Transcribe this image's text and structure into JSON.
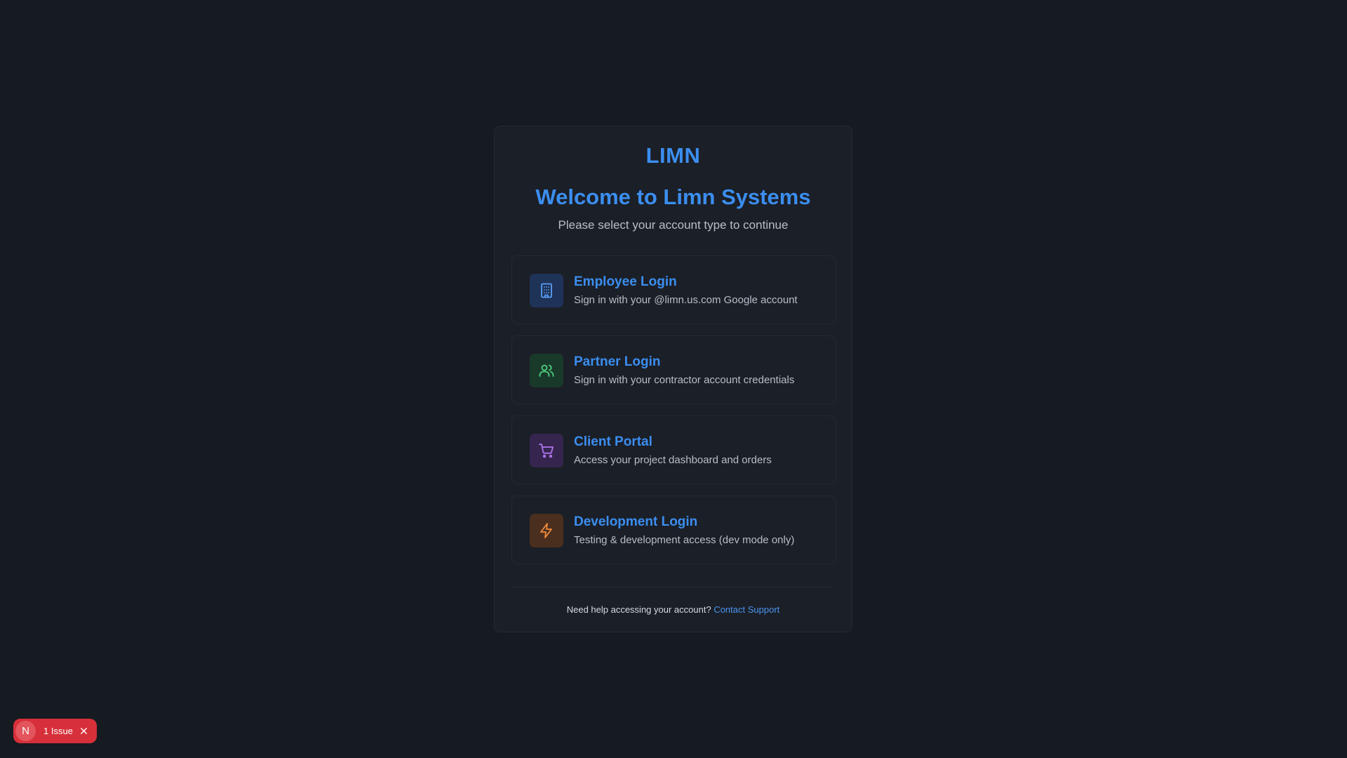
{
  "brand": "LIMN",
  "title": "Welcome to Limn Systems",
  "subtitle": "Please select your account type to continue",
  "options": [
    {
      "title": "Employee Login",
      "description": "Sign in with your @limn.us.com Google account",
      "icon": "building-icon",
      "icon_color": "#5b9cf5",
      "icon_bg": "#1f3358"
    },
    {
      "title": "Partner Login",
      "description": "Sign in with your contractor account credentials",
      "icon": "users-icon",
      "icon_color": "#4fcf7f",
      "icon_bg": "#193a2a"
    },
    {
      "title": "Client Portal",
      "description": "Access your project dashboard and orders",
      "icon": "shopping-cart-icon",
      "icon_color": "#b175f0",
      "icon_bg": "#36254f"
    },
    {
      "title": "Development Login",
      "description": "Testing & development access (dev mode only)",
      "icon": "lightning-bolt-icon",
      "icon_color": "#f08a3c",
      "icon_bg": "#4a2f1f"
    }
  ],
  "footer": {
    "text": "Need help accessing your account?",
    "link": "Contact Support"
  },
  "issue_badge": {
    "letter": "N",
    "label": "1 Issue"
  },
  "colors": {
    "background": "#161a21",
    "card": "#1b1f27",
    "accent": "#3b8ef0",
    "issue_red": "#d7303a"
  }
}
